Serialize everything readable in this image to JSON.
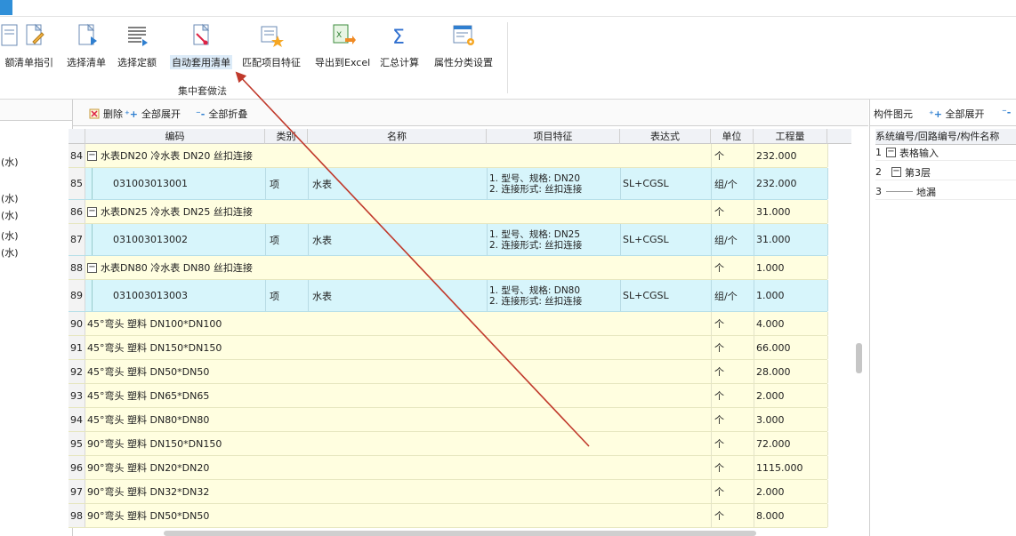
{
  "ribbon": {
    "buttons": [
      {
        "label": "额",
        "icon": "document-icon"
      },
      {
        "label": "清单指引",
        "icon": "document-edit-icon"
      },
      {
        "label": "选择清单",
        "icon": "document-select-icon"
      },
      {
        "label": "选择定额",
        "icon": "list-select-icon"
      },
      {
        "label": "自动套用清单",
        "icon": "auto-apply-icon"
      },
      {
        "label": "匹配项目特征",
        "icon": "match-feature-icon"
      },
      {
        "label": "导出到Excel",
        "icon": "excel-export-icon"
      },
      {
        "label": "汇总计算",
        "icon": "sum-icon"
      },
      {
        "label": "属性分类设置",
        "icon": "settings-grid-icon"
      }
    ],
    "group_label": "集中套做法"
  },
  "left_panel": {
    "items": [
      "(水)",
      "(水)",
      "(水)",
      "(水)",
      "(水)"
    ]
  },
  "mid_toolbar": {
    "delete": "删除",
    "expand_all": "全部展开",
    "collapse_all": "全部折叠"
  },
  "grid": {
    "headers": [
      "编码",
      "类别",
      "名称",
      "项目特征",
      "表达式",
      "单位",
      "工程量"
    ],
    "rows": [
      {
        "num": "84",
        "type": "group",
        "code": "水表DN20 冷水表 DN20 丝扣连接",
        "unit": "个",
        "qty": "232.000"
      },
      {
        "num": "85",
        "type": "item",
        "code": "031003013001",
        "category": "项",
        "name": "水表",
        "feature1": "1. 型号、规格: DN20",
        "feature2": "2. 连接形式: 丝扣连接",
        "expr": "SL+CGSL",
        "unit": "组/个",
        "qty": "232.000"
      },
      {
        "num": "86",
        "type": "group",
        "code": "水表DN25 冷水表 DN25 丝扣连接",
        "unit": "个",
        "qty": "31.000"
      },
      {
        "num": "87",
        "type": "item",
        "code": "031003013002",
        "category": "项",
        "name": "水表",
        "feature1": "1. 型号、规格: DN25",
        "feature2": "2. 连接形式: 丝扣连接",
        "expr": "SL+CGSL",
        "unit": "组/个",
        "qty": "31.000"
      },
      {
        "num": "88",
        "type": "group",
        "code": "水表DN80 冷水表 DN80 丝扣连接",
        "unit": "个",
        "qty": "1.000"
      },
      {
        "num": "89",
        "type": "item",
        "code": "031003013003",
        "category": "项",
        "name": "水表",
        "feature1": "1. 型号、规格: DN80",
        "feature2": "2. 连接形式: 丝扣连接",
        "expr": "SL+CGSL",
        "unit": "组/个",
        "qty": "1.000"
      },
      {
        "num": "90",
        "type": "leaf",
        "code": "45°弯头 塑料 DN100*DN100",
        "unit": "个",
        "qty": "4.000"
      },
      {
        "num": "91",
        "type": "leaf",
        "code": "45°弯头 塑料 DN150*DN150",
        "unit": "个",
        "qty": "66.000"
      },
      {
        "num": "92",
        "type": "leaf",
        "code": "45°弯头 塑料 DN50*DN50",
        "unit": "个",
        "qty": "28.000"
      },
      {
        "num": "93",
        "type": "leaf",
        "code": "45°弯头 塑料 DN65*DN65",
        "unit": "个",
        "qty": "2.000"
      },
      {
        "num": "94",
        "type": "leaf",
        "code": "45°弯头 塑料 DN80*DN80",
        "unit": "个",
        "qty": "3.000"
      },
      {
        "num": "95",
        "type": "leaf",
        "code": "90°弯头 塑料 DN150*DN150",
        "unit": "个",
        "qty": "72.000"
      },
      {
        "num": "96",
        "type": "leaf",
        "code": "90°弯头 塑料 DN20*DN20",
        "unit": "个",
        "qty": "1115.000"
      },
      {
        "num": "97",
        "type": "leaf",
        "code": "90°弯头 塑料 DN32*DN32",
        "unit": "个",
        "qty": "2.000"
      },
      {
        "num": "98",
        "type": "leaf",
        "code": "90°弯头 塑料 DN50*DN50",
        "unit": "个",
        "qty": "8.000"
      }
    ]
  },
  "right_panel": {
    "title": "构件图元",
    "expand_all": "全部展开",
    "header": "系统编号/回路编号/构件名称",
    "rows": [
      {
        "num": "1",
        "label": "表格输入"
      },
      {
        "num": "2",
        "label": "第3层"
      },
      {
        "num": "3",
        "label": "地漏"
      }
    ]
  },
  "colors": {
    "group_row": "#fffee0",
    "item_row": "#d7f5fb",
    "arrow": "#c0392b",
    "accent": "#2f8fd8"
  }
}
